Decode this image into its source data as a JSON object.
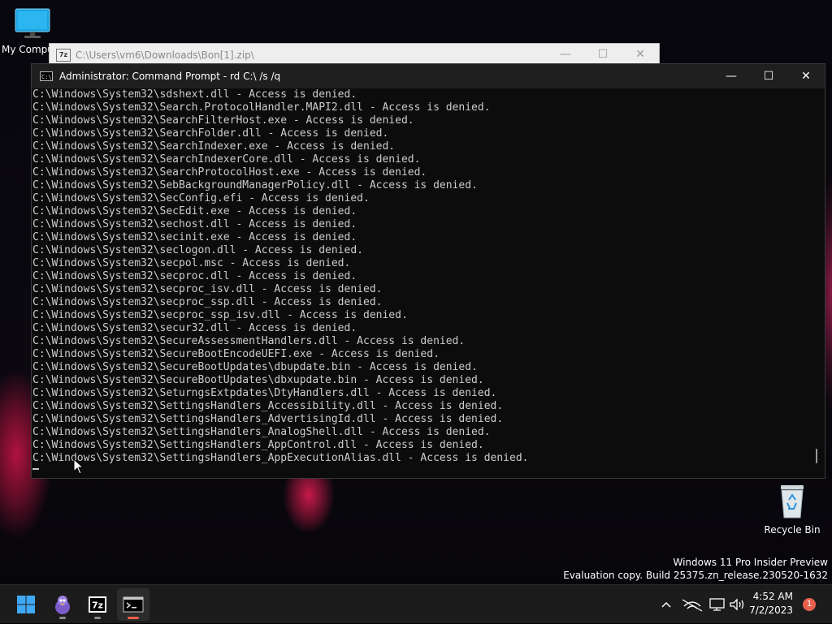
{
  "desktop": {
    "icons": {
      "my_computer": "My Computer",
      "recycle_bin": "Recycle Bin"
    },
    "watermark": {
      "line1": "Windows 11 Pro Insider Preview",
      "line2": "Evaluation copy. Build 25375.zn_release.230520-1632"
    }
  },
  "zip_window": {
    "app_icon": "7z",
    "title": "C:\\Users\\vm6\\Downloads\\Bon[1].zip\\"
  },
  "cmd_window": {
    "app_icon": "C:\\",
    "title": "Administrator:  Command Prompt - rd  C:\\ /s /q",
    "lines": [
      "C:\\Windows\\System32\\sdshext.dll - Access is denied.",
      "C:\\Windows\\System32\\Search.ProtocolHandler.MAPI2.dll - Access is denied.",
      "C:\\Windows\\System32\\SearchFilterHost.exe - Access is denied.",
      "C:\\Windows\\System32\\SearchFolder.dll - Access is denied.",
      "C:\\Windows\\System32\\SearchIndexer.exe - Access is denied.",
      "C:\\Windows\\System32\\SearchIndexerCore.dll - Access is denied.",
      "C:\\Windows\\System32\\SearchProtocolHost.exe - Access is denied.",
      "C:\\Windows\\System32\\SebBackgroundManagerPolicy.dll - Access is denied.",
      "C:\\Windows\\System32\\SecConfig.efi - Access is denied.",
      "C:\\Windows\\System32\\SecEdit.exe - Access is denied.",
      "C:\\Windows\\System32\\sechost.dll - Access is denied.",
      "C:\\Windows\\System32\\secinit.exe - Access is denied.",
      "C:\\Windows\\System32\\seclogon.dll - Access is denied.",
      "C:\\Windows\\System32\\secpol.msc - Access is denied.",
      "C:\\Windows\\System32\\secproc.dll - Access is denied.",
      "C:\\Windows\\System32\\secproc_isv.dll - Access is denied.",
      "C:\\Windows\\System32\\secproc_ssp.dll - Access is denied.",
      "C:\\Windows\\System32\\secproc_ssp_isv.dll - Access is denied.",
      "C:\\Windows\\System32\\secur32.dll - Access is denied.",
      "C:\\Windows\\System32\\SecureAssessmentHandlers.dll - Access is denied.",
      "C:\\Windows\\System32\\SecureBootEncodeUEFI.exe - Access is denied.",
      "C:\\Windows\\System32\\SecureBootUpdates\\dbupdate.bin - Access is denied.",
      "C:\\Windows\\System32\\SecureBootUpdates\\dbxupdate.bin - Access is denied.",
      "C:\\Windows\\System32\\SeturngsExtpdates\\DtyHandlers.dll - Access is denied.",
      "C:\\Windows\\System32\\SettingsHandlers_Accessibility.dll - Access is denied.",
      "C:\\Windows\\System32\\SettingsHandlers_AdvertisingId.dll - Access is denied.",
      "C:\\Windows\\System32\\SettingsHandlers_AnalogShell.dll - Access is denied.",
      "C:\\Windows\\System32\\SettingsHandlers_AppControl.dll - Access is denied.",
      "C:\\Windows\\System32\\SettingsHandlers_AppExecutionAlias.dll - Access is denied."
    ]
  },
  "taskbar": {
    "apps": [
      "windows-start-icon",
      "mascot-app-icon",
      "7zip-app-icon",
      "terminal-app-icon"
    ],
    "tray_icons": [
      "chevron-up-icon",
      "network-disconnected-icon",
      "display-icon",
      "speaker-icon"
    ],
    "time": "4:52 AM",
    "date": "7/2/2023",
    "notification_count": "1"
  },
  "colors": {
    "console_bg": "#0c0c0c",
    "console_text": "#cccccc",
    "titlebar": "#1f1f1f",
    "taskbar": "#1c1c1c",
    "accent_badge": "#e8604c"
  }
}
